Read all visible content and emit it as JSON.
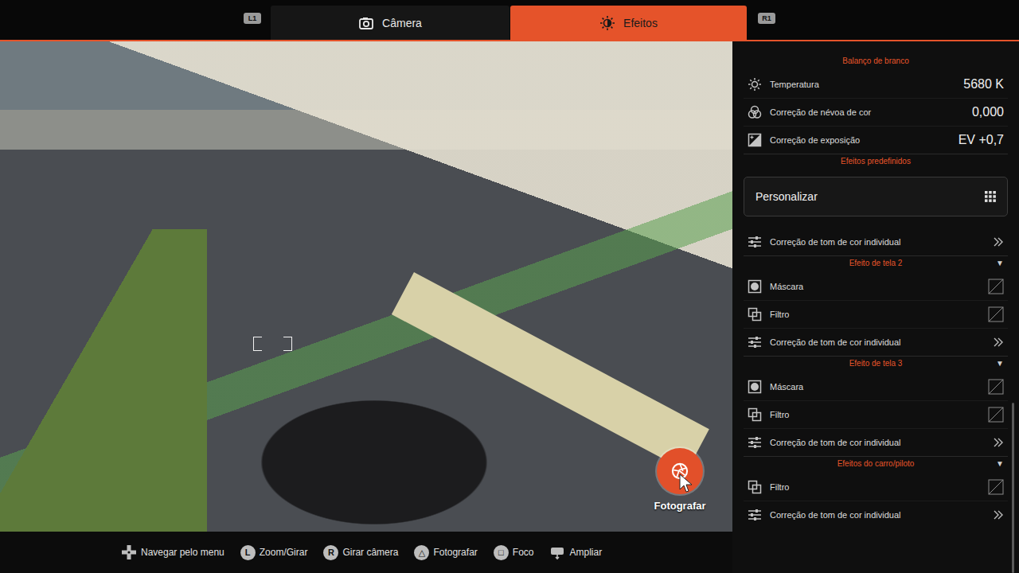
{
  "tab_bar": {
    "left_button": "L1",
    "right_button": "R1",
    "tabs": [
      {
        "label": "Câmera",
        "selected": false
      },
      {
        "label": "Efeitos",
        "selected": true
      }
    ]
  },
  "viewport": {
    "shutter": {
      "label": "Fotografar"
    }
  },
  "panel": {
    "scrollbar": {
      "level": 0.32
    },
    "sections": [
      {
        "title": "Balanço de branco",
        "rows": [
          {
            "kind": "value",
            "label": "Temperatura",
            "value": "5680 K"
          },
          {
            "kind": "value",
            "label": "Correção de névoa de cor",
            "value": "0,000"
          },
          {
            "kind": "value",
            "label": "Correção de exposição",
            "value": "EV +0,7"
          }
        ]
      },
      {
        "title": "Efeitos predefinidos",
        "rows": [
          {
            "kind": "dropdown",
            "label": "Personalizar"
          },
          {
            "kind": "link",
            "label": "Correção de tom de cor individual"
          }
        ]
      },
      {
        "title": "Efeito de tela 2",
        "toggle": "▼",
        "expanded": true,
        "rows": [
          {
            "kind": "checkbox",
            "label": "Máscara",
            "checked": false
          },
          {
            "kind": "checkbox",
            "label": "Filtro",
            "checked": false
          },
          {
            "kind": "link",
            "label": "Correção de tom de cor individual"
          }
        ]
      },
      {
        "title": "Efeito de tela 3",
        "toggle": "▼",
        "expanded": true,
        "rows": [
          {
            "kind": "checkbox",
            "label": "Máscara",
            "checked": false
          },
          {
            "kind": "checkbox",
            "label": "Filtro",
            "checked": false
          },
          {
            "kind": "link",
            "label": "Correção de tom de cor individual"
          }
        ]
      },
      {
        "title": "Efeitos do carro/piloto",
        "toggle": "▼",
        "expanded": true,
        "rows": [
          {
            "kind": "checkbox",
            "label": "Filtro",
            "checked": false
          },
          {
            "kind": "link",
            "label": "Correção de tom de cor individual"
          }
        ]
      }
    ]
  },
  "hints": [
    {
      "kind": "icon",
      "label": "Navegar pelo menu"
    },
    {
      "kind": "key",
      "key": "L",
      "label": "Zoom/Girar"
    },
    {
      "kind": "key",
      "key": "R",
      "label": "Girar câmera"
    },
    {
      "kind": "key",
      "key": "△",
      "label": "Fotografar"
    },
    {
      "kind": "key",
      "key": "□",
      "label": "Foco"
    },
    {
      "kind": "icon",
      "label": "Ampliar"
    }
  ]
}
